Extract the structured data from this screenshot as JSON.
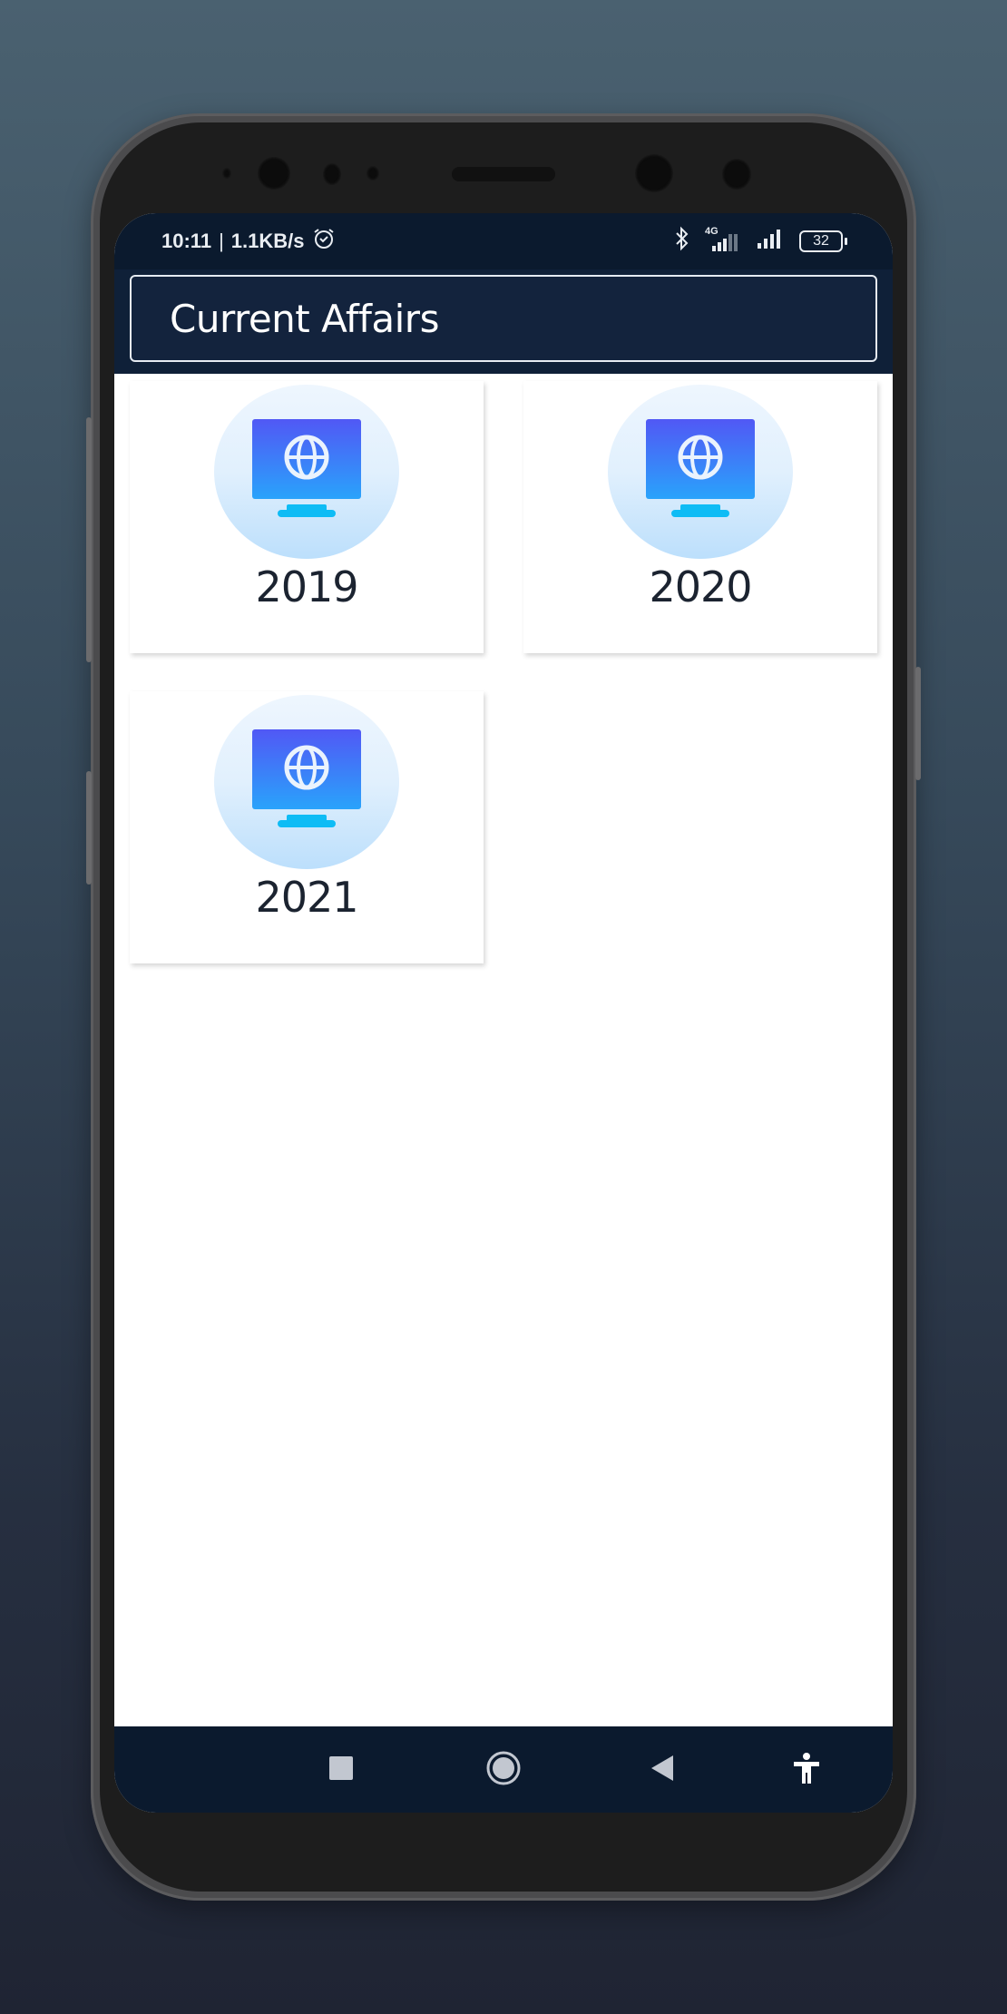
{
  "status_bar": {
    "time": "10:11",
    "separator": "|",
    "network_speed": "1.1KB/s",
    "alarm_icon": "alarm-clock-icon",
    "bluetooth_icon": "bluetooth-icon",
    "network_type": "4G",
    "signal_icon": "signal-icon",
    "battery_level": "32"
  },
  "app_bar": {
    "title": "Current Affairs"
  },
  "categories": [
    {
      "label": "2019",
      "icon": "monitor-globe-icon"
    },
    {
      "label": "2020",
      "icon": "monitor-globe-icon"
    },
    {
      "label": "2021",
      "icon": "monitor-globe-icon"
    }
  ],
  "navigation_bar": {
    "recents_icon": "recents-square-icon",
    "home_icon": "home-circle-icon",
    "back_icon": "back-triangle-icon",
    "accessibility_icon": "accessibility-icon"
  },
  "colors": {
    "status_bar_bg": "#0b1a2e",
    "app_bar_bg": "#13233d",
    "monitor_top": "#5158f5",
    "monitor_bottom": "#29a3fb",
    "stand": "#0ebcf5",
    "label_text": "#1b2330"
  }
}
